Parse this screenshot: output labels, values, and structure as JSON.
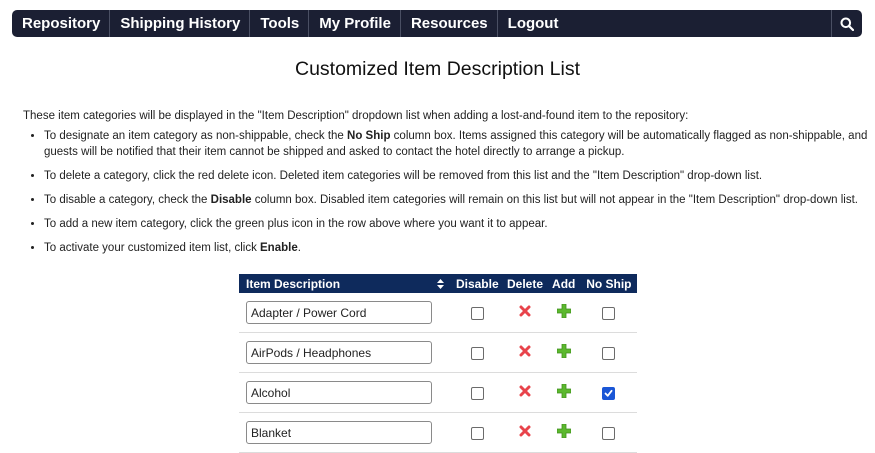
{
  "nav": {
    "items": [
      "Repository",
      "Shipping History",
      "Tools",
      "My Profile",
      "Resources",
      "Logout"
    ],
    "search_icon": "search-icon"
  },
  "page": {
    "title": "Customized Item Description List",
    "intro": "These item categories will be displayed in the \"Item Description\" dropdown list when adding a lost-and-found item to the repository:"
  },
  "instructions": [
    {
      "pre": "To designate an item category as non-shippable, check the ",
      "bold": "No Ship",
      "post": " column box. Items assigned this category will be automatically flagged as non-shippable, and guests will be notified that their item cannot be shipped and asked to contact the hotel directly to arrange a pickup."
    },
    {
      "pre": "To delete a category, click the red delete icon. Deleted item categories will be removed from this list and the \"Item Description\" drop-down list.",
      "bold": "",
      "post": ""
    },
    {
      "pre": "To disable a category, check the ",
      "bold": "Disable",
      "post": " column box. Disabled item categories will remain on this list but will not appear in the \"Item Description\" drop-down list."
    },
    {
      "pre": "To add a new item category, click the green plus icon in the row above where you want it to appear.",
      "bold": "",
      "post": ""
    },
    {
      "pre": "To activate your customized item list, click ",
      "bold": "Enable",
      "post": "."
    }
  ],
  "table": {
    "headers": {
      "description": "Item Description",
      "disable": "Disable",
      "delete": "Delete",
      "add": "Add",
      "no_ship": "No Ship"
    },
    "rows": [
      {
        "description": "Adapter / Power Cord",
        "disabled": false,
        "no_ship": false
      },
      {
        "description": "AirPods / Headphones",
        "disabled": false,
        "no_ship": false
      },
      {
        "description": "Alcohol",
        "disabled": false,
        "no_ship": true
      },
      {
        "description": "Blanket",
        "disabled": false,
        "no_ship": false
      }
    ]
  },
  "colors": {
    "navbar": "#1b1f33",
    "table_header": "#0e2a5c",
    "delete_icon": "#e8434b",
    "add_icon": "#5cb82e",
    "checkbox_checked": "#1a56d6"
  }
}
